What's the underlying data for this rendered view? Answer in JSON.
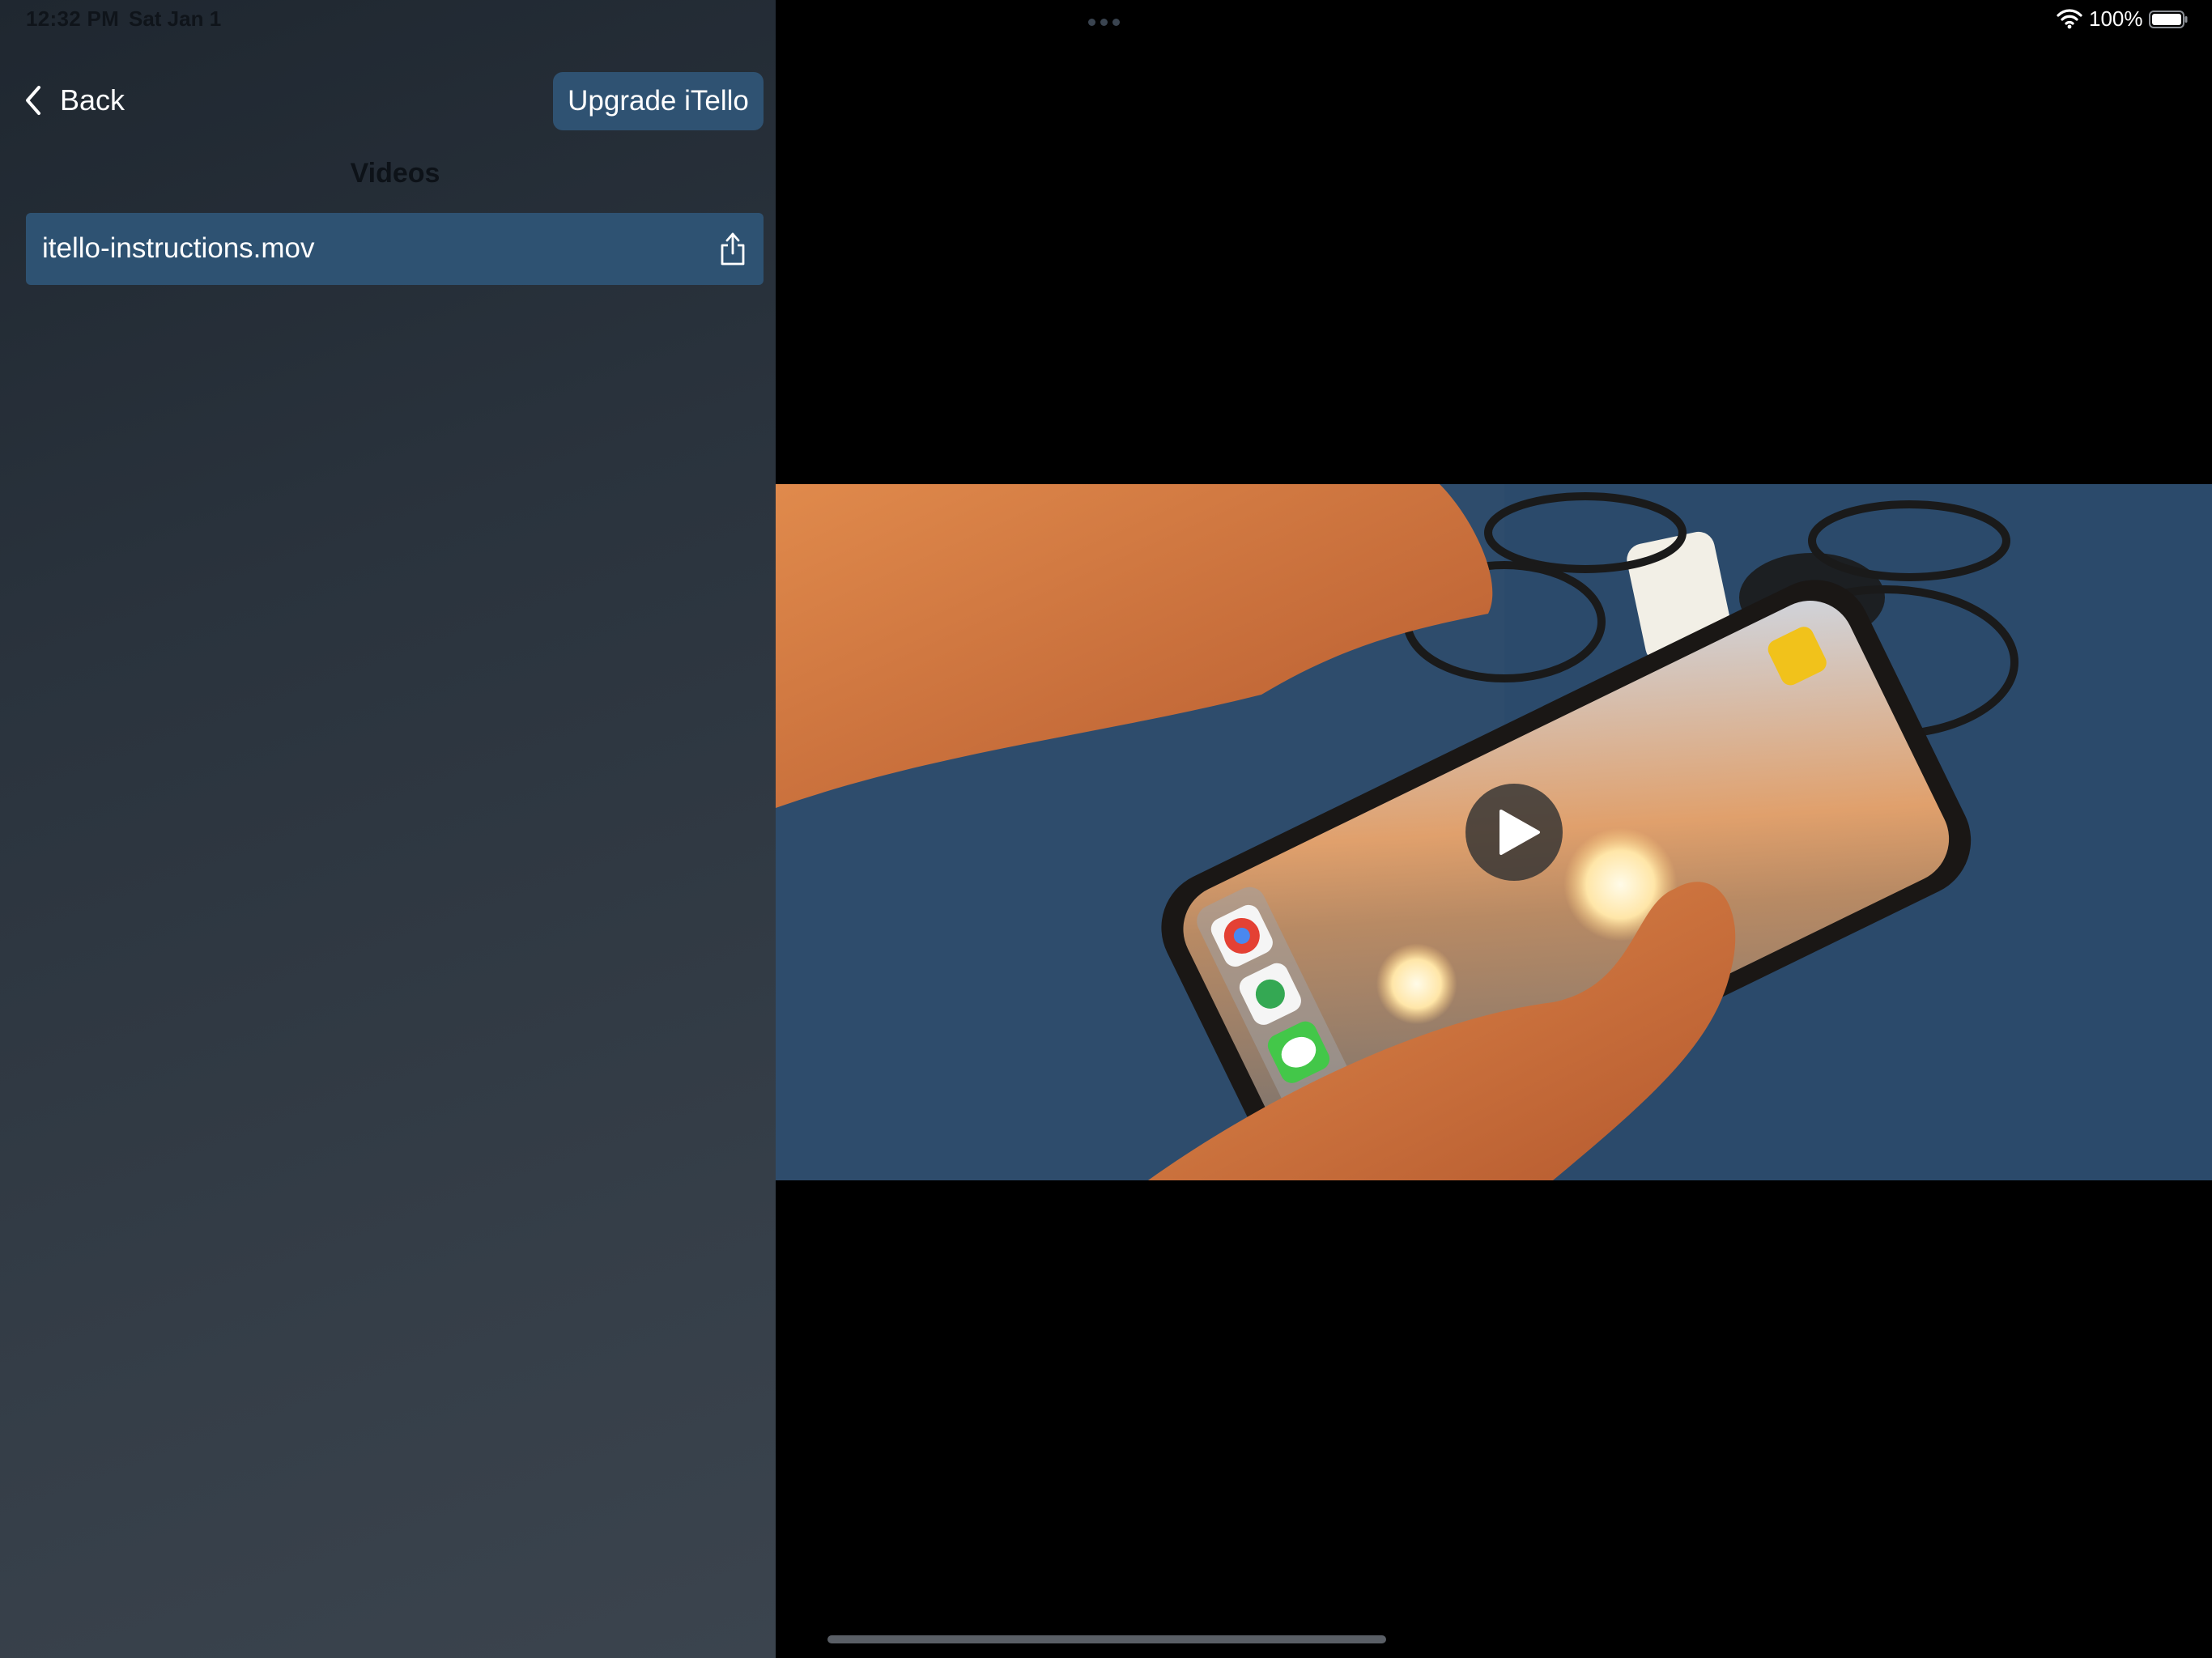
{
  "status_bar": {
    "time": "12:32 PM",
    "date": "Sat Jan 1",
    "battery_percent": "100%",
    "wifi_icon": "wifi-icon",
    "battery_icon": "battery-full-icon"
  },
  "nav": {
    "back_label": "Back",
    "back_icon": "chevron-left-icon",
    "upgrade_label": "Upgrade iTello"
  },
  "videos": {
    "title": "Videos",
    "items": [
      {
        "filename": "itello-instructions.mov",
        "share_icon": "share-icon"
      }
    ]
  },
  "player": {
    "play_icon": "play-icon",
    "state": "paused"
  },
  "colors": {
    "accent": "#2e5272",
    "sidebar_bg": "#2f3944",
    "video_bg": "#000000"
  }
}
